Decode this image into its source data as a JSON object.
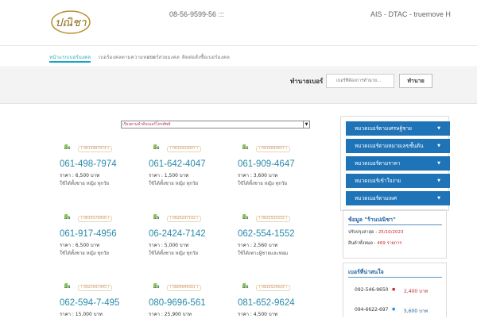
{
  "header": {
    "logo_text": "ปณิชา",
    "phone": "08-56-9599-56 :::",
    "networks": "AIS - DTAC - truemove H"
  },
  "nav": {
    "items": [
      {
        "label": "หน้าแรกเบอร์มงคล",
        "active": true
      },
      {
        "label": "เบอร์มงคลตามความหมาย",
        "active": false
      },
      {
        "label": "เบอร์สวยมงคล",
        "active": false
      },
      {
        "label": "ติดต่อสั่งซื้อเบอร์มงคล",
        "active": false
      }
    ]
  },
  "search": {
    "label": "ทำนายเบอร์",
    "placeholder": "เบอร์ที่ต้องการทำนาย...",
    "button": "ทำนาย"
  },
  "sort": {
    "selected": "เรียงตามลำดับเบอร์โทรศัพท์"
  },
  "cards": [
    {
      "network": "AIS",
      "digits": "( 0614987974 )",
      "number": "061-498-7974",
      "price": "ราคา : 6,500 บาท",
      "desc": "ใช้ได้ทั้งชาย หญิง ทุกวัย"
    },
    {
      "network": "AIS",
      "digits": "( 0616424047 )",
      "number": "061-642-4047",
      "price": "ราคา : 1,500 บาท",
      "desc": "ใช้ได้ทั้งชาย หญิง ทุกวัย"
    },
    {
      "network": "AIS",
      "digits": "( 0619094647 )",
      "number": "061-909-4647",
      "price": "ราคา : 3,600 บาท",
      "desc": "ใช้ได้ทั้งชาย หญิง ทุกวัย"
    },
    {
      "network": "AIS",
      "digits": "( 0619174956 )",
      "number": "061-917-4956",
      "price": "ราคา : 6,500 บาท",
      "desc": "ใช้ได้ทั้งชาย หญิง ทุกวัย"
    },
    {
      "network": "AIS",
      "digits": "( 0624247142 )",
      "number": "06-2424-7142",
      "price": "ราคา : 5,000 บาท",
      "desc": "ใช้ได้ทั้งชาย หญิง ทุกวัย"
    },
    {
      "network": "AIS",
      "digits": "( 0625541552 )",
      "number": "062-554-1552",
      "price": "ราคา : 2,560 บาท",
      "desc": "ใช้ได้เพาะผู้ชายและทอม"
    },
    {
      "network": "AIS",
      "digits": "( 0625947495 )",
      "number": "062-594-7-495",
      "price": "ราคา : 15,000 บาท",
      "desc": ""
    },
    {
      "network": "AIS",
      "digits": "( 0809696561 )",
      "number": "080-9696-561",
      "price": "ราคา : 25,900 บาท",
      "desc": ""
    },
    {
      "network": "AIS",
      "digits": "( 0816529624 )",
      "number": "081-652-9624",
      "price": "ราคา : 4,500 บาท",
      "desc": ""
    }
  ],
  "sidebar": {
    "categories": [
      {
        "label": "หมวดเบอร์ตามเศรษฐ์ชาย"
      },
      {
        "label": "หมวดเบอร์ตามหมายเลขชั้นต้น"
      },
      {
        "label": "หมวดเบอร์ตามราคา"
      },
      {
        "label": "หมวดเบอร์เข้าใจง่าย"
      },
      {
        "label": "หมวดเบอร์ตามเพศ"
      }
    ],
    "info": {
      "title": "ข้อมูล \"ร้านปณิชา\"",
      "updated_label": "ปรับปรุงล่าสุด :",
      "updated_value": "25/10/2023",
      "stock_label": "สินค้าทั้งหมด :",
      "stock_value": "469 รายการ"
    },
    "hot": {
      "title": "เบอร์ที่น่าสนใจ",
      "items": [
        {
          "number": "092-546-9650",
          "price": "2,400 บาท",
          "color": "#c62828"
        },
        {
          "number": "094-6622-697",
          "price": "5,600 บาท",
          "color": "#1f5f9f"
        }
      ]
    }
  }
}
